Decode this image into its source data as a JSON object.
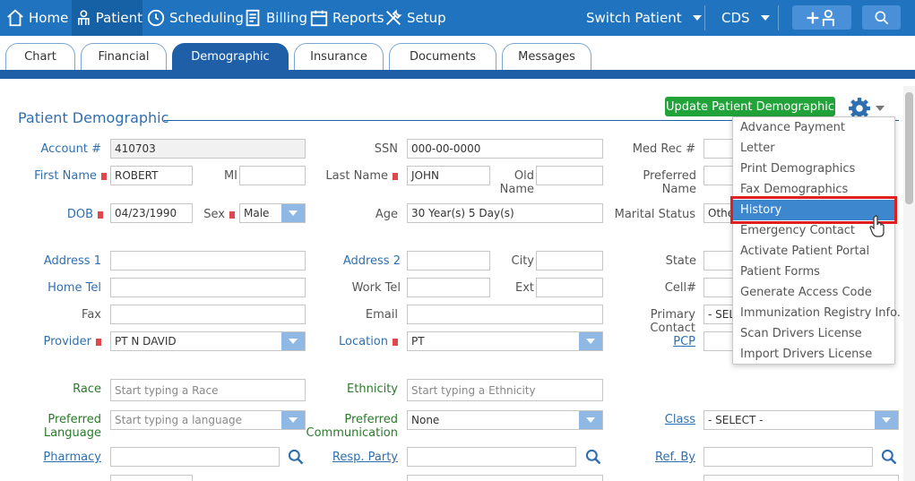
{
  "nav": {
    "home": "Home",
    "patient": "Patient",
    "scheduling": "Scheduling",
    "billing": "Billing",
    "reports": "Reports",
    "setup": "Setup",
    "switch_patient": "Switch Patient",
    "cds": "CDS"
  },
  "tabs": [
    "Chart",
    "Financial",
    "Demographic",
    "Insurance",
    "Documents",
    "Messages"
  ],
  "active_tab": "Demographic",
  "section": {
    "title": "Patient Demographic",
    "update_button": "Update Patient Demographic"
  },
  "labels": {
    "account": "Account #",
    "ssn": "SSN",
    "medrec": "Med Rec #",
    "first_name": "First Name",
    "mi": "MI",
    "last_name": "Last Name",
    "old": "Old",
    "name": "Name",
    "preferred_name": "Preferred Name",
    "dob": "DOB",
    "sex": "Sex",
    "age": "Age",
    "marital": "Marital Status",
    "address1": "Address 1",
    "address2": "Address 2",
    "city": "City",
    "state": "State",
    "home_tel": "Home Tel",
    "work_tel": "Work Tel",
    "ext": "Ext",
    "cell": "Cell#",
    "fax": "Fax",
    "email": "Email",
    "primary_contact": "Primary Contact",
    "provider": "Provider",
    "location": "Location",
    "pcp": "PCP",
    "race": "Race",
    "ethnicity": "Ethnicity",
    "preferred": "Preferred",
    "language": "Language",
    "communication": "Communication",
    "class": "Class",
    "pharmacy": "Pharmacy",
    "resp_party": "Resp. Party",
    "ref_by": "Ref. By"
  },
  "values": {
    "account": "410703",
    "ssn": "000-00-0000",
    "first_name": "ROBERT",
    "last_name": "JOHN",
    "dob": "04/23/1990",
    "sex": "Male",
    "age": "30 Year(s) 5 Day(s)",
    "marital": "Othe",
    "primary_contact": "- SELE",
    "provider": "PT N DAVID",
    "location": "PT",
    "race_placeholder": "Start typing a Race",
    "ethnicity_placeholder": "Start typing a Ethnicity",
    "language_placeholder": "Start typing a language",
    "communication": "None",
    "class": "- SELECT -"
  },
  "gear_menu": {
    "items": [
      "Advance Payment",
      "Letter",
      "Print Demographics",
      "Fax Demographics",
      "History",
      "Emergency Contact",
      "Activate Patient Portal",
      "Patient Forms",
      "Generate Access Code",
      "Immunization Registry Info.",
      "Scan Drivers License",
      "Import Drivers License"
    ],
    "highlighted": "History"
  },
  "colors": {
    "nav": "#1f73bf",
    "tab_active": "#1f5fa8",
    "update_button": "#21a33a",
    "menu_highlight": "#3d87cf",
    "highlight_box": "#e02020"
  }
}
